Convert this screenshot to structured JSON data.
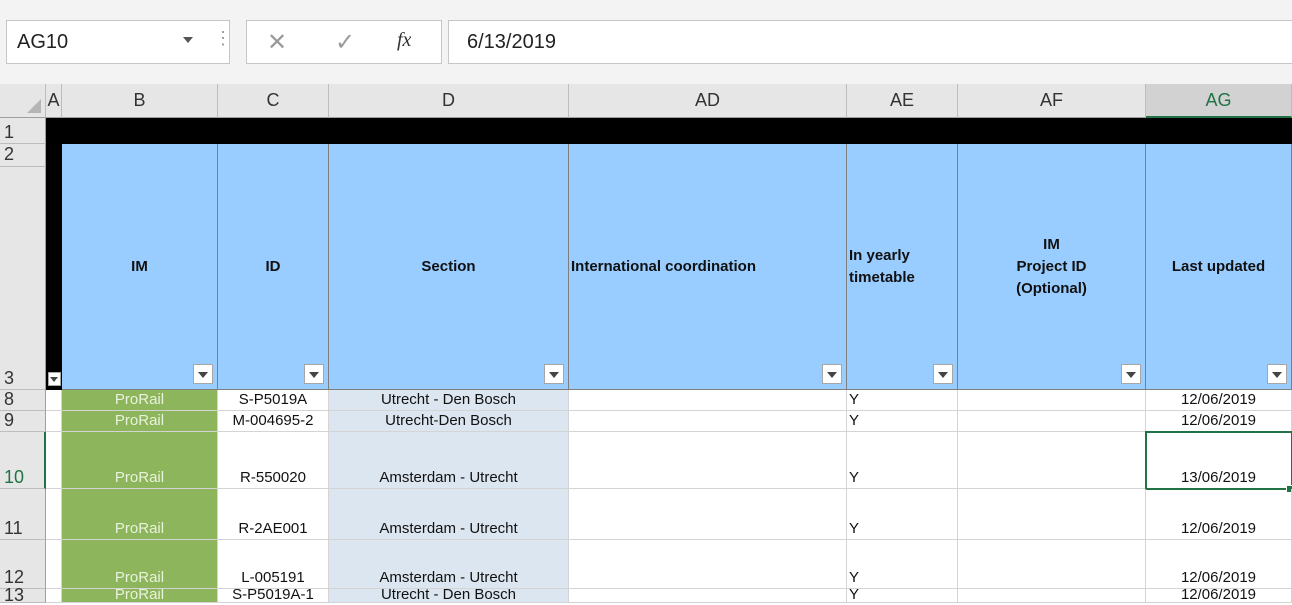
{
  "formula_bar": {
    "name_box": "AG10",
    "formula": "6/13/2019",
    "cancel_icon": "close-icon",
    "enter_icon": "checkmark-icon",
    "fx_icon": "fx-icon",
    "fx_label": "fx"
  },
  "columns": [
    "A",
    "B",
    "C",
    "D",
    "AD",
    "AE",
    "AF",
    "AG"
  ],
  "selected_column": "AG",
  "row_numbers": [
    "1",
    "2",
    "3",
    "8",
    "9",
    "10",
    "11",
    "12",
    "13"
  ],
  "selected_row": "10",
  "headers": {
    "im": "IM",
    "id": "ID",
    "section": "Section",
    "intl": "International coordination",
    "yearly": "In yearly\ntimetable",
    "projid": "IM\nProject ID\n(Optional)",
    "updated": "Last updated"
  },
  "rows": [
    {
      "row": "8",
      "im": "ProRail",
      "id": "S-P5019A",
      "section": "Utrecht - Den Bosch",
      "intl": "",
      "yearly": "Y",
      "projid": "",
      "updated": "12/06/2019"
    },
    {
      "row": "9",
      "im": "ProRail",
      "id": "M-004695-2",
      "section": "Utrecht-Den Bosch",
      "intl": "",
      "yearly": "Y",
      "projid": "",
      "updated": "12/06/2019"
    },
    {
      "row": "10",
      "im": "ProRail",
      "id": "R-550020",
      "section": "Amsterdam - Utrecht",
      "intl": "",
      "yearly": "Y",
      "projid": "",
      "updated": "13/06/2019"
    },
    {
      "row": "11",
      "im": "ProRail",
      "id": "R-2AE001",
      "section": "Amsterdam - Utrecht",
      "intl": "",
      "yearly": "Y",
      "projid": "",
      "updated": "12/06/2019"
    },
    {
      "row": "12",
      "im": "ProRail",
      "id": "L-005191",
      "section": "Amsterdam - Utrecht",
      "intl": "",
      "yearly": "Y",
      "projid": "",
      "updated": "12/06/2019"
    },
    {
      "row": "13",
      "im": "ProRail",
      "id": "S-P5019A-1",
      "section": "Utrecht - Den Bosch",
      "intl": "",
      "yearly": "Y",
      "projid": "",
      "updated": "12/06/2019"
    }
  ],
  "colors": {
    "header_fill": "#99ccff",
    "im_fill": "#8db55b",
    "section_fill": "#dce6f1",
    "selection": "#217346"
  }
}
